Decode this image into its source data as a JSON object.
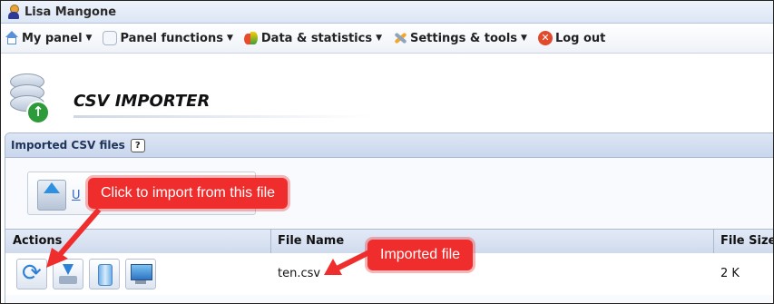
{
  "user": {
    "name": "Lisa Mangone"
  },
  "menu": {
    "items": [
      {
        "label": "My panel",
        "icon": "home-icon"
      },
      {
        "label": "Panel functions",
        "icon": "hexagon-icon"
      },
      {
        "label": "Data & statistics",
        "icon": "chart-icon"
      },
      {
        "label": "Settings & tools",
        "icon": "tools-icon"
      },
      {
        "label": "Log out",
        "icon": "logout-icon"
      }
    ]
  },
  "page": {
    "title": "CSV IMPORTER"
  },
  "panel": {
    "title": "Imported CSV files",
    "help": "?",
    "upload_link": "U"
  },
  "table": {
    "headers": {
      "actions": "Actions",
      "file_name": "File Name",
      "file_size": "File Size"
    },
    "rows": [
      {
        "file_name": "ten.csv",
        "file_size": "2 K"
      }
    ]
  },
  "callouts": {
    "import": "Click to import from this file",
    "imported": "Imported file"
  },
  "colors": {
    "callout": "#f02d2d",
    "link": "#3366cc",
    "header_bg": "#cfdbee"
  }
}
